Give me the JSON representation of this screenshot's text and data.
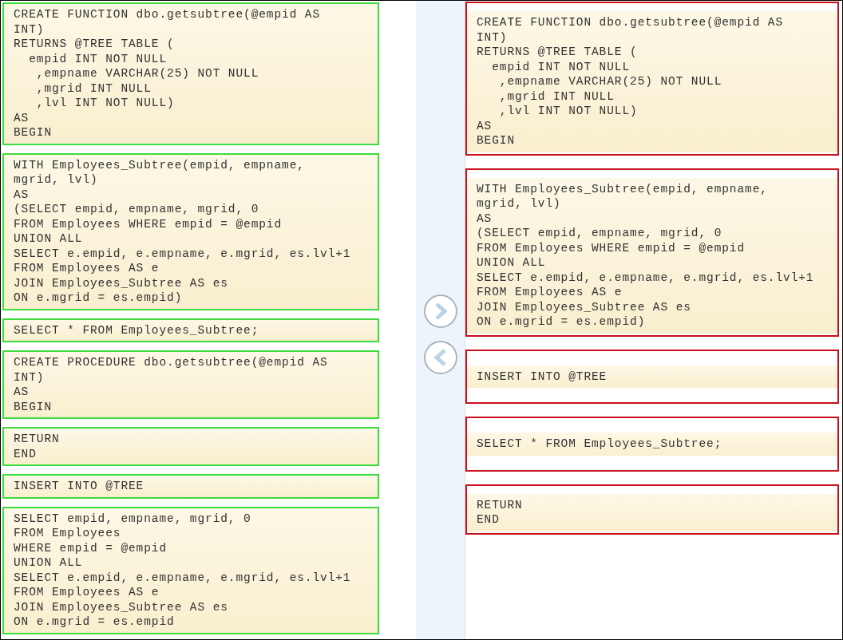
{
  "source_blocks": [
    {
      "code": "CREATE FUNCTION dbo.getsubtree(@empid AS\nINT)\nRETURNS @TREE TABLE (\n  empid INT NOT NULL\n   ,empname VARCHAR(25) NOT NULL\n   ,mgrid INT NULL\n   ,lvl INT NOT NULL)\nAS\nBEGIN"
    },
    {
      "code": "WITH Employees_Subtree(empid, empname,\nmgrid, lvl)\nAS\n(SELECT empid, empname, mgrid, 0\nFROM Employees WHERE empid = @empid\nUNION ALL\nSELECT e.empid, e.empname, e.mgrid, es.lvl+1\nFROM Employees AS e\nJOIN Employees_Subtree AS es\nON e.mgrid = es.empid)"
    },
    {
      "code": "SELECT * FROM Employees_Subtree;"
    },
    {
      "code": "CREATE PROCEDURE dbo.getsubtree(@empid AS\nINT)\nAS\nBEGIN"
    },
    {
      "code": "RETURN\nEND"
    },
    {
      "code": "INSERT INTO @TREE"
    },
    {
      "code": "SELECT empid, empname, mgrid, 0\nFROM Employees\nWHERE empid = @empid\nUNION ALL\nSELECT e.empid, e.empname, e.mgrid, es.lvl+1\nFROM Employees AS e\nJOIN Employees_Subtree AS es\nON e.mgrid = es.empid"
    }
  ],
  "answer_slots": [
    {
      "code": "CREATE FUNCTION dbo.getsubtree(@empid AS\nINT)\nRETURNS @TREE TABLE (\n  empid INT NOT NULL\n   ,empname VARCHAR(25) NOT NULL\n   ,mgrid INT NULL\n   ,lvl INT NOT NULL)\nAS\nBEGIN"
    },
    {
      "code": "WITH Employees_Subtree(empid, empname,\nmgrid, lvl)\nAS\n(SELECT empid, empname, mgrid, 0\nFROM Employees WHERE empid = @empid\nUNION ALL\nSELECT e.empid, e.empname, e.mgrid, es.lvl+1\nFROM Employees AS e\nJOIN Employees_Subtree AS es\nON e.mgrid = es.empid)"
    },
    {
      "code": "INSERT INTO @TREE"
    },
    {
      "code": "SELECT * FROM Employees_Subtree;"
    },
    {
      "code": "RETURN\nEND"
    }
  ]
}
